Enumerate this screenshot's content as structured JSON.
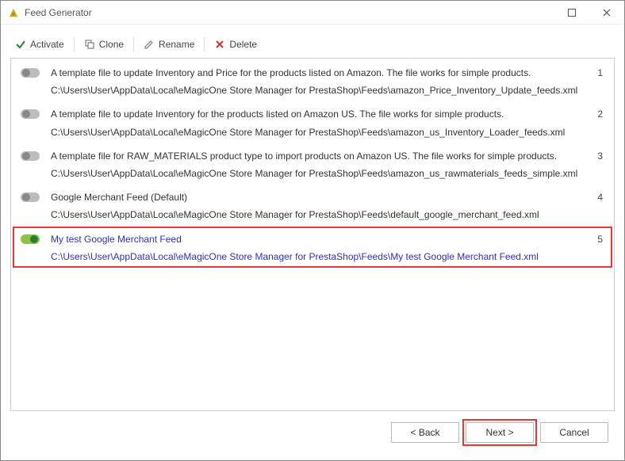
{
  "window": {
    "title": "Feed Generator"
  },
  "toolbar": {
    "activate": "Activate",
    "clone": "Clone",
    "rename": "Rename",
    "delete": "Delete"
  },
  "feeds": [
    {
      "index": "1",
      "active": false,
      "title": "A template file to update Inventory and Price for the products listed on Amazon. The file works for simple products.",
      "path": "C:\\Users\\User\\AppData\\Local\\eMagicOne Store Manager for PrestaShop\\Feeds\\amazon_Price_Inventory_Update_feeds.xml"
    },
    {
      "index": "2",
      "active": false,
      "title": "A template file to update Inventory for the products listed on Amazon US. The file works for simple products.",
      "path": "C:\\Users\\User\\AppData\\Local\\eMagicOne Store Manager for PrestaShop\\Feeds\\amazon_us_Inventory_Loader_feeds.xml"
    },
    {
      "index": "3",
      "active": false,
      "title": "A template file for RAW_MATERIALS product type to import products on Amazon US. The file works for simple products.",
      "path": "C:\\Users\\User\\AppData\\Local\\eMagicOne Store Manager for PrestaShop\\Feeds\\amazon_us_rawmaterials_feeds_simple.xml"
    },
    {
      "index": "4",
      "active": false,
      "title": "Google Merchant Feed (Default)",
      "path": "C:\\Users\\User\\AppData\\Local\\eMagicOne Store Manager for PrestaShop\\Feeds\\default_google_merchant_feed.xml"
    },
    {
      "index": "5",
      "active": true,
      "selected": true,
      "title": "My test Google Merchant Feed",
      "path": "C:\\Users\\User\\AppData\\Local\\eMagicOne Store Manager for PrestaShop\\Feeds\\My test Google Merchant Feed.xml"
    }
  ],
  "footer": {
    "back": "< Back",
    "next": "Next >",
    "cancel": "Cancel"
  },
  "colors": {
    "accent_green": "#2e7d32",
    "highlight_red": "#e53935",
    "selected_text": "#3030c0"
  }
}
